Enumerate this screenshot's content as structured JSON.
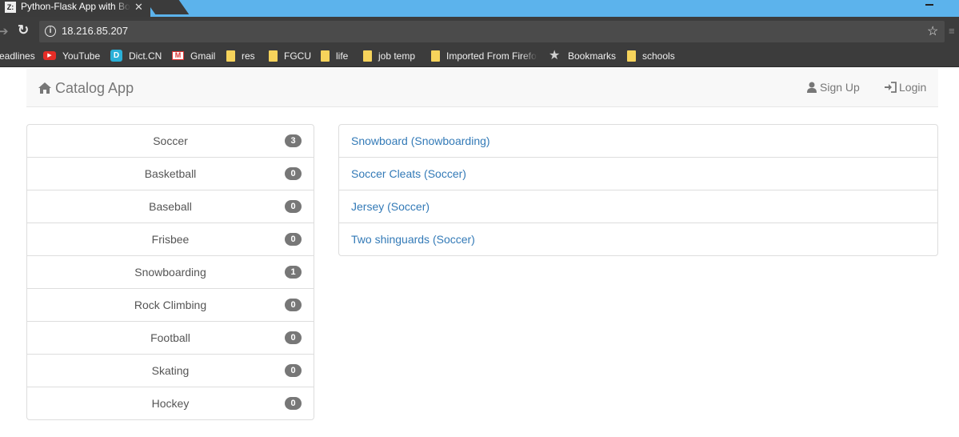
{
  "browser": {
    "tab_title": "Python-Flask App with Bo",
    "tab_favicon": "Z:",
    "url": "18.216.85.207",
    "bookmarks": [
      {
        "label": "eadlines",
        "icon": "none"
      },
      {
        "label": "YouTube",
        "icon": "youtube-icon"
      },
      {
        "label": "Dict.CN",
        "icon": "dict-icon"
      },
      {
        "label": "Gmail",
        "icon": "gmail-icon"
      },
      {
        "label": "res",
        "icon": "folder-icon"
      },
      {
        "label": "FGCU",
        "icon": "folder-icon"
      },
      {
        "label": "life",
        "icon": "folder-icon"
      },
      {
        "label": "job temp",
        "icon": "folder-icon"
      },
      {
        "label": "Imported From Firefox",
        "icon": "folder-icon"
      },
      {
        "label": "Bookmarks",
        "icon": "star-icon"
      },
      {
        "label": "schools",
        "icon": "folder-icon"
      }
    ]
  },
  "navbar": {
    "brand": "Catalog App",
    "signup": "Sign Up",
    "login": "Login"
  },
  "categories": [
    {
      "name": "Soccer",
      "count": "3"
    },
    {
      "name": "Basketball",
      "count": "0"
    },
    {
      "name": "Baseball",
      "count": "0"
    },
    {
      "name": "Frisbee",
      "count": "0"
    },
    {
      "name": "Snowboarding",
      "count": "1"
    },
    {
      "name": "Rock Climbing",
      "count": "0"
    },
    {
      "name": "Football",
      "count": "0"
    },
    {
      "name": "Skating",
      "count": "0"
    },
    {
      "name": "Hockey",
      "count": "0"
    }
  ],
  "items": [
    "Snowboard (Snowboarding)",
    "Soccer Cleats (Soccer)",
    "Jersey (Soccer)",
    "Two shinguards (Soccer)"
  ],
  "colors": {
    "link": "#337ab7",
    "badge": "#777777",
    "navbar_bg": "#f8f8f8",
    "chrome_dark": "#3c3c3c",
    "tabstrip": "#5cb3ec"
  }
}
